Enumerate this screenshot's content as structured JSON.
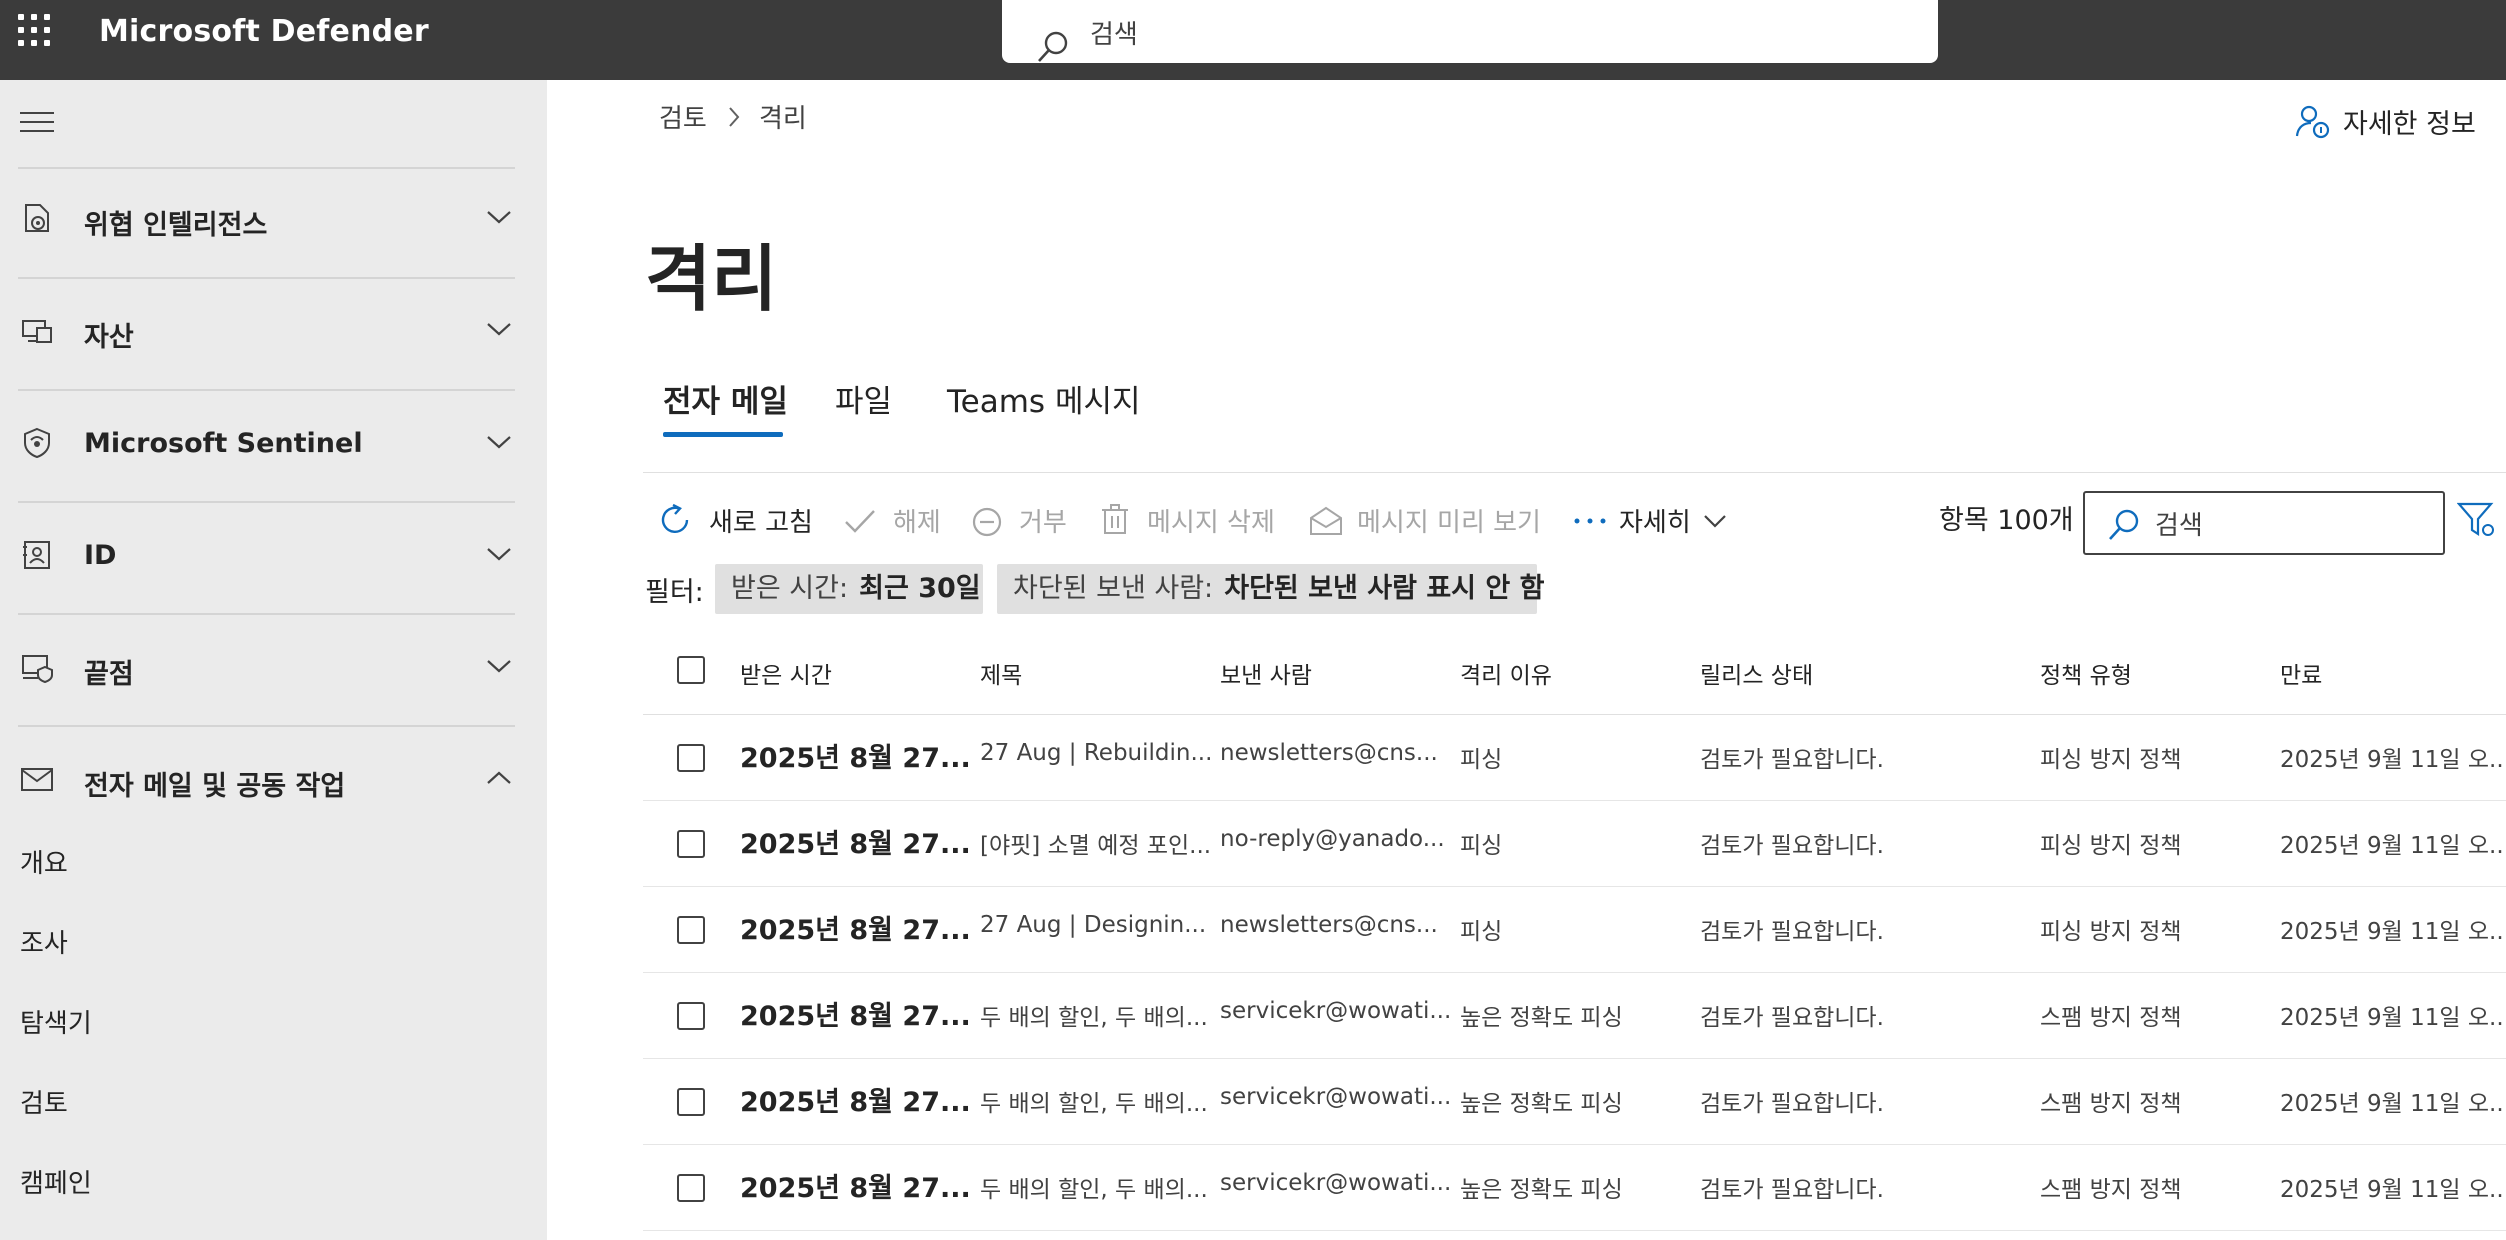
{
  "app": {
    "title": "Microsoft Defender",
    "search_placeholder": "검색"
  },
  "sidebar": {
    "groups": [
      {
        "label": "위협 인텔리전스",
        "icon": "threat-intel-icon",
        "state": "collapsed"
      },
      {
        "label": "자산",
        "icon": "assets-icon",
        "state": "collapsed"
      },
      {
        "label": "Microsoft Sentinel",
        "icon": "sentinel-icon",
        "state": "collapsed"
      },
      {
        "label": "ID",
        "icon": "identity-icon",
        "state": "collapsed"
      },
      {
        "label": "끝점",
        "icon": "endpoint-icon",
        "state": "collapsed"
      },
      {
        "label": "전자 메일 및 공동 작업",
        "icon": "mail-icon",
        "state": "expanded"
      }
    ],
    "sub_items": [
      "개요",
      "조사",
      "탐색기",
      "검토",
      "캠페인"
    ]
  },
  "breadcrumb": [
    "검토",
    "격리"
  ],
  "more_info_label": "자세한 정보",
  "page_title": "격리",
  "tabs": [
    {
      "label": "전자 메일",
      "selected": true
    },
    {
      "label": "파일",
      "selected": false
    },
    {
      "label": "Teams 메시지",
      "selected": false
    }
  ],
  "toolbar": {
    "refresh": "새로 고침",
    "release": "해제",
    "deny": "거부",
    "delete": "메시지 삭제",
    "preview": "메시지 미리 보기",
    "more": "자세히",
    "count": "항목 100개",
    "search_placeholder": "검색"
  },
  "filters": {
    "label": "필터:",
    "chips": [
      {
        "key": "받은 시간:",
        "value": "최근 30일"
      },
      {
        "key": "차단된 보낸 사람:",
        "value": "차단된 보낸 사람 표시 안 함"
      }
    ]
  },
  "table": {
    "columns": [
      "받은 시간",
      "제목",
      "보낸 사람",
      "격리 이유",
      "릴리스 상태",
      "정책 유형",
      "만료"
    ],
    "rows": [
      [
        "2025년 8월 27...",
        "27 Aug | Rebuildin...",
        "newsletters@cns...",
        "피싱",
        "검토가 필요합니다.",
        "피싱 방지 정책",
        "2025년 9월 11일 오..."
      ],
      [
        "2025년 8월 27...",
        "[야핏] 소멸 예정 포인...",
        "no-reply@yanado...",
        "피싱",
        "검토가 필요합니다.",
        "피싱 방지 정책",
        "2025년 9월 11일 오..."
      ],
      [
        "2025년 8월 27...",
        "27 Aug | Designin...",
        "newsletters@cns...",
        "피싱",
        "검토가 필요합니다.",
        "피싱 방지 정책",
        "2025년 9월 11일 오..."
      ],
      [
        "2025년 8월 27...",
        "두 배의 할인, 두 배의...",
        "servicekr@wowati...",
        "높은 정확도 피싱",
        "검토가 필요합니다.",
        "스팸 방지 정책",
        "2025년 9월 11일 오..."
      ],
      [
        "2025년 8월 27...",
        "두 배의 할인, 두 배의...",
        "servicekr@wowati...",
        "높은 정확도 피싱",
        "검토가 필요합니다.",
        "스팸 방지 정책",
        "2025년 9월 11일 오..."
      ],
      [
        "2025년 8월 27...",
        "두 배의 할인, 두 배의...",
        "servicekr@wowati...",
        "높은 정확도 피싱",
        "검토가 필요합니다.",
        "스팸 방지 정책",
        "2025년 9월 11일 오..."
      ]
    ]
  },
  "colors": {
    "topbar": "#3b3b3b",
    "sidebar": "#ebebeb",
    "accent": "#0f6cbd",
    "disabled": "#a6a6a6"
  }
}
